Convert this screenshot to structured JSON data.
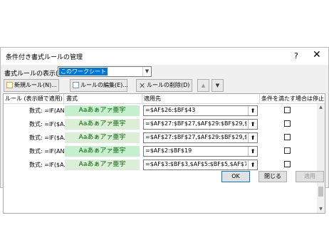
{
  "dialog": {
    "title": "条件付き書式ルールの管理",
    "help": "?",
    "close": "✕"
  },
  "scope": {
    "label": "書式ルールの表示(S):",
    "value": "このワークシート"
  },
  "toolbar": {
    "new_rule": "新規ルール(N)...",
    "edit_rule": "ルールの編集(E)...",
    "delete_rule": "ルールの削除(D)"
  },
  "columns": {
    "rule": "ルール (表示順で適用)",
    "format": "書式",
    "applies_to": "適用先",
    "stop_if_true": "条件を満たす場合は停止"
  },
  "rules": [
    {
      "rule": "数式: =IF(AN...",
      "format": "Aaあぁアァ亜宇",
      "applies_to": "=$AF$26:$BF$43",
      "stop": false
    },
    {
      "rule": "数式: =IF($A...",
      "format": "Aaあぁアァ亜宇",
      "applies_to": "=$AF$27:$BF$27,$AF$29:$BF$29,$A",
      "stop": false
    },
    {
      "rule": "数式: =IF($A...",
      "format": "Aaあぁアァ亜宇",
      "applies_to": "=$AF$27:$BF$27,$AF$29:$BF$29,$A",
      "stop": false
    },
    {
      "rule": "数式: =IF(AN...",
      "format": "Aaあぁアァ亜宇",
      "applies_to": "=$AF$2:$BF$19",
      "stop": false
    },
    {
      "rule": "数式: =IF($A...",
      "format": "Aaあぁアァ亜宇",
      "applies_to": "=$AF$3:$BF$3,$AF$5:$BF$5,$AF$7:$",
      "stop": false
    }
  ],
  "buttons": {
    "ok": "OK",
    "close": "閉じる",
    "apply": "適用"
  },
  "icons": {
    "collapse": "⬆"
  }
}
